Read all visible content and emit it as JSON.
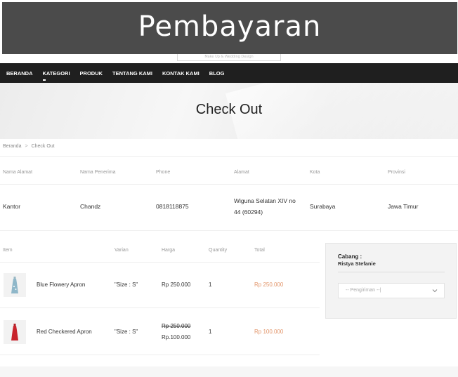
{
  "banner": {
    "title": "Pembayaran"
  },
  "logo": {
    "tagline": "Make Up & Wedding Design"
  },
  "nav": {
    "items": [
      "BERANDA",
      "KATEGORI",
      "PRODUK",
      "TENTANG KAMI",
      "KONTAK KAMI",
      "BLOG"
    ],
    "active_index": 1
  },
  "hero": {
    "title": "Check Out"
  },
  "breadcrumb": {
    "home": "Beranda",
    "separator": ">",
    "current": "Check Out"
  },
  "address": {
    "headers": [
      "Nama Alamat",
      "Nama Penerima",
      "Phone",
      "Alamat",
      "Kota",
      "Provinsi"
    ],
    "values": {
      "name": "Kantor",
      "recipient": "Chandz",
      "phone": "0818118875",
      "address_line1": "Wiguna Selatan XIV no",
      "address_line2": "44 (60294)",
      "city": "Surabaya",
      "province": "Jawa Timur"
    }
  },
  "items": {
    "headers": [
      "Item",
      "Varian",
      "Harga",
      "Quantity",
      "Total"
    ],
    "rows": [
      {
        "name": "Blue Flowery Apron",
        "variant": "\"Size : S\"",
        "price": "Rp 250.000",
        "old_price": "",
        "quantity": "1",
        "total": "Rp 250.000",
        "thumb_icon": "blue-apron-image",
        "thumb_color": "#8fb7c9"
      },
      {
        "name": "Red Checkered Apron",
        "variant": "\"Size : S\"",
        "price": "Rp.100.000",
        "old_price": "Rp 250.000",
        "quantity": "1",
        "total": "Rp 100.000",
        "thumb_icon": "red-apron-image",
        "thumb_color": "#c8232c"
      }
    ]
  },
  "sidebar": {
    "cabang_label": "Cabang :",
    "cabang_name": "Ristya Stefanie",
    "shipping_placeholder": "-- Pengiriman --|",
    "chevron_icon": "chevron-down-icon"
  },
  "colors": {
    "nav_bg": "#1f1f1f",
    "banner_bg": "#4b4b4b",
    "total_accent": "#e2956a"
  }
}
